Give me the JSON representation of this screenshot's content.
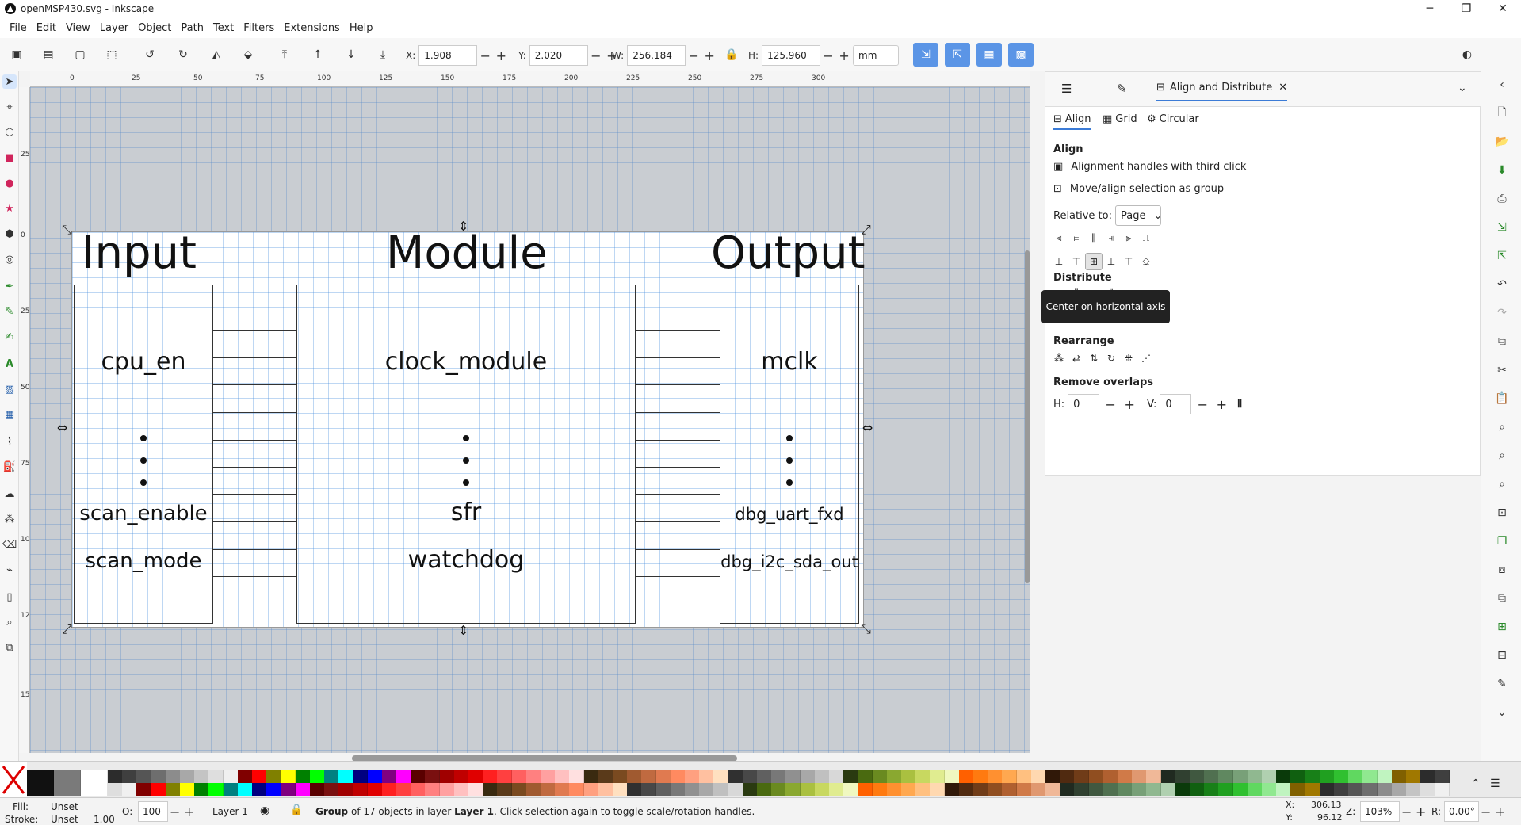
{
  "window": {
    "title": "openMSP430.svg - Inkscape"
  },
  "menu": [
    "File",
    "Edit",
    "View",
    "Layer",
    "Object",
    "Path",
    "Text",
    "Filters",
    "Extensions",
    "Help"
  ],
  "toolbar": {
    "x_label": "X:",
    "x_value": "1.908",
    "y_label": "Y:",
    "y_value": "2.020",
    "w_label": "W:",
    "w_value": "256.184",
    "h_label": "H:",
    "h_value": "125.960",
    "unit": "mm"
  },
  "ruler_h": [
    "0",
    "25",
    "50",
    "75",
    "100",
    "125",
    "150",
    "175",
    "200",
    "225",
    "250",
    "275",
    "300"
  ],
  "ruler_v": [
    "25",
    "0",
    "25",
    "50",
    "75",
    "100",
    "125",
    "150"
  ],
  "drawing": {
    "input_title": "Input",
    "module_title": "Module",
    "output_title": "Output",
    "inputs": [
      "cpu_en",
      "scan_enable",
      "scan_mode"
    ],
    "modules": [
      "clock_module",
      "sfr",
      "watchdog"
    ],
    "outputs": [
      "mclk",
      "dbg_uart_fxd",
      "dbg_i2c_sda_out"
    ]
  },
  "dock": {
    "tab_active": "Align and Distribute",
    "subtabs": [
      "Align",
      "Grid",
      "Circular"
    ],
    "align_title": "Align",
    "opt_handles": "Alignment handles with third click",
    "opt_group": "Move/align selection as group",
    "relative_label": "Relative to:",
    "relative_value": "Page",
    "distribute_title": "Distribute",
    "rearrange_title": "Rearrange",
    "remove_title": "Remove overlaps",
    "h_label": "H:",
    "h_value": "0",
    "v_label": "V:",
    "v_value": "0",
    "tooltip": "Center on horizontal axis"
  },
  "status": {
    "fill_label": "Fill:",
    "fill_value": "Unset",
    "stroke_label": "Stroke:",
    "stroke_value": "Unset",
    "stroke_width": "1.00",
    "opacity_label": "O:",
    "opacity_value": "100",
    "layer": "Layer 1",
    "message_pre": "Group",
    "message_mid": " of 17 objects in layer ",
    "message_layer": "Layer 1",
    "message_post": ". Click selection again to toggle scale/rotation handles.",
    "cx_label": "X:",
    "cx": "306.13",
    "cy_label": "Y:",
    "cy": "96.12",
    "zoom_label": "Z:",
    "zoom": "103%",
    "rot_label": "R:",
    "rot": "0.00°"
  },
  "palette_colors": [
    "#111111",
    "#7a7a7a",
    "#ffffff",
    "#2c2c2c",
    "#3f3f3f",
    "#555555",
    "#6e6e6e",
    "#8c8c8c",
    "#a8a8a8",
    "#c4c4c4",
    "#dedede",
    "#f0f0f0",
    "#800000",
    "#ff0000",
    "#808000",
    "#ffff00",
    "#008000",
    "#00ff00",
    "#008080",
    "#00ffff",
    "#000080",
    "#0000ff",
    "#800080",
    "#ff00ff",
    "#5a0000",
    "#7a1010",
    "#a00000",
    "#c00000",
    "#e00000",
    "#ff2020",
    "#ff4040",
    "#ff6060",
    "#ff8080",
    "#ffa0a0",
    "#ffc0c0",
    "#ffe0e0",
    "#3a2a10",
    "#5a3a1a",
    "#7a4a20",
    "#a05a30",
    "#c06a40",
    "#e07a50",
    "#ff8a60",
    "#ffa080",
    "#ffc0a0",
    "#ffe0c0",
    "#303030",
    "#484848",
    "#606060",
    "#787878",
    "#909090",
    "#a8a8a8",
    "#c0c0c0",
    "#d8d8d8",
    "#2a3a10",
    "#4a6a10",
    "#6a8a20",
    "#8aa830",
    "#aac040",
    "#c8d860",
    "#e0ec90",
    "#f0f8c0",
    "#ff6000",
    "#ff7a10",
    "#ff9030",
    "#ffa850",
    "#ffc080",
    "#ffd8b0",
    "#301808",
    "#502a10",
    "#703c18",
    "#904e20",
    "#b06030",
    "#d07a48",
    "#e09870",
    "#f0b898",
    "#202a20",
    "#304030",
    "#405840",
    "#507050",
    "#608860",
    "#78a078",
    "#90b890",
    "#b0d0b0",
    "#0a3a0a",
    "#106010",
    "#188018",
    "#20a020",
    "#30c030",
    "#60d860",
    "#90e890",
    "#c0f4c0",
    "#806000",
    "#a07800"
  ]
}
